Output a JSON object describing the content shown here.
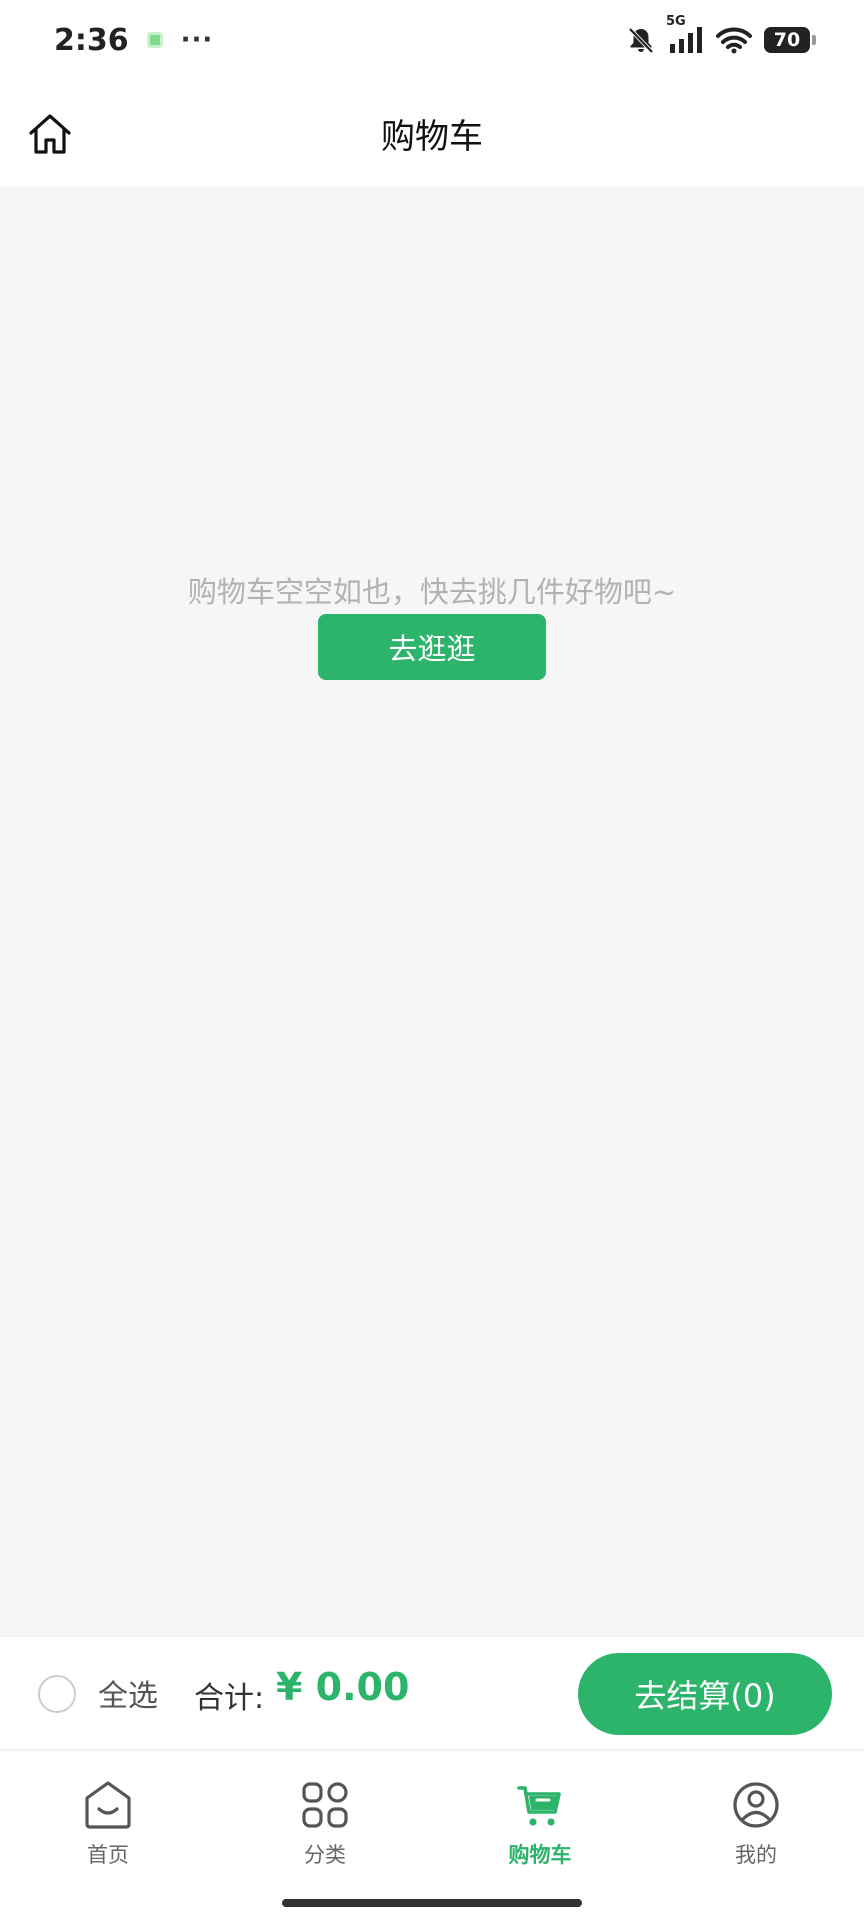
{
  "status_bar": {
    "time": "2:36",
    "more": "···",
    "network": "5G",
    "battery": "70"
  },
  "header": {
    "title": "购物车",
    "home_icon": "home-outline-icon"
  },
  "empty_state": {
    "message": "购物车空空如也，快去挑几件好物吧~",
    "button_label": "去逛逛"
  },
  "checkout": {
    "select_all_label": "全选",
    "total_label": "合计:",
    "total_amount": "¥ 0.00",
    "checkout_label": "去结算(0)"
  },
  "tabs": [
    {
      "label": "首页",
      "icon": "home-smile-icon",
      "active": false
    },
    {
      "label": "分类",
      "icon": "category-grid-icon",
      "active": false
    },
    {
      "label": "购物车",
      "icon": "cart-icon",
      "active": true
    },
    {
      "label": "我的",
      "icon": "user-icon",
      "active": false
    }
  ],
  "colors": {
    "accent": "#2cb46b",
    "background": "#f6f6f6",
    "muted_text": "#b2b2b2"
  }
}
